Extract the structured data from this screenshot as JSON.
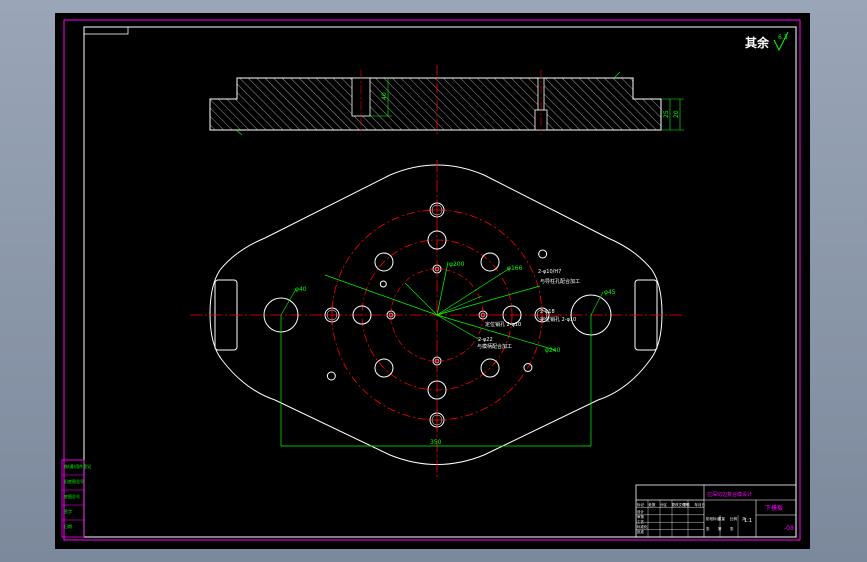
{
  "viewer": {
    "background_color": "#8f9aac",
    "sheet_color": "#000000",
    "frame_color": "#ff00ff"
  },
  "colors": {
    "outline": "#ffffff",
    "centerline": "#ff0000",
    "dimension": "#00ff00",
    "title_text": "#ff00ff",
    "hatch": "#ffffff"
  },
  "surface_finish": {
    "label": "其余",
    "value": "6.3"
  },
  "dimensions": {
    "hole_d40": "φ40",
    "hole_d45": "φ45",
    "pcd_200": "φ200",
    "pcd_166": "φ166",
    "pcd_240": "φ240",
    "width_350": "350",
    "section_depth_a": "40",
    "section_depth_b": "20",
    "section_depth_c": "25",
    "hole_spec_top": "2-φ10/H7",
    "hole_spec_right": "2-φ18",
    "hole_spec_low": "2-φ22"
  },
  "notes": {
    "note_top": "与导柱孔配合加工",
    "note_mid_a": "定位销孔 2-φ10",
    "note_mid_b": "定位销孔 2-φ10",
    "note_low": "与模柄配合加工"
  },
  "left_block": {
    "rows": [
      "借(通)用件登记",
      "旧底图总号",
      "底图总号",
      "签字",
      "日期"
    ],
    "small_labels": [
      "标记",
      "处数"
    ]
  },
  "title_block": {
    "top_stamp": "拉深切边复合模设计",
    "drawing_name": "下模板",
    "drawing_number": "-08",
    "scale": "1:1",
    "grid_labels": [
      "标记",
      "处数",
      "分区",
      "更改文件号",
      "签名",
      "年月日",
      "设计",
      "审核",
      "工艺",
      "标准化",
      "批准",
      "阶段标记",
      "重量",
      "比例",
      "共",
      "张",
      "第",
      "张"
    ]
  }
}
